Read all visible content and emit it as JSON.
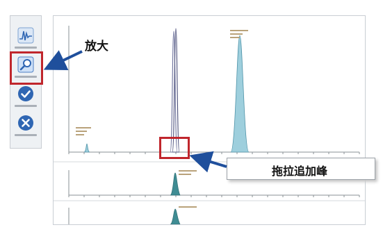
{
  "toolbar": {
    "tools": [
      {
        "name": "peak-waveform-tool",
        "icon": "waveform-icon"
      },
      {
        "name": "zoom-tool",
        "icon": "magnifier-icon",
        "selected": true
      },
      {
        "name": "finish-tool",
        "icon": "check-circle-icon"
      },
      {
        "name": "cancel-tool",
        "icon": "x-circle-icon"
      }
    ]
  },
  "chart": {
    "traces": [
      {
        "name": "main-trace",
        "peaks": [
          {
            "rt": 0.2,
            "rel": 0.08
          },
          {
            "rt": 1.68,
            "rel": 1.0
          },
          {
            "rt": 2.7,
            "rel": 0.96
          }
        ]
      },
      {
        "name": "trace-2",
        "peaks": [
          {
            "rt": 1.72,
            "rel": 0.9
          }
        ]
      },
      {
        "name": "trace-3",
        "peaks": [
          {
            "rt": 1.72,
            "rel": 0.9
          }
        ]
      }
    ],
    "peak_fill": "#9ecfdd"
  },
  "callouts": {
    "zoom": "放大",
    "drag_add_peak": "拖拉追加峰"
  },
  "colors": {
    "highlight": "#c0262c",
    "arrow": "#1f4f9c",
    "icon_blue": "#2f66b3"
  }
}
